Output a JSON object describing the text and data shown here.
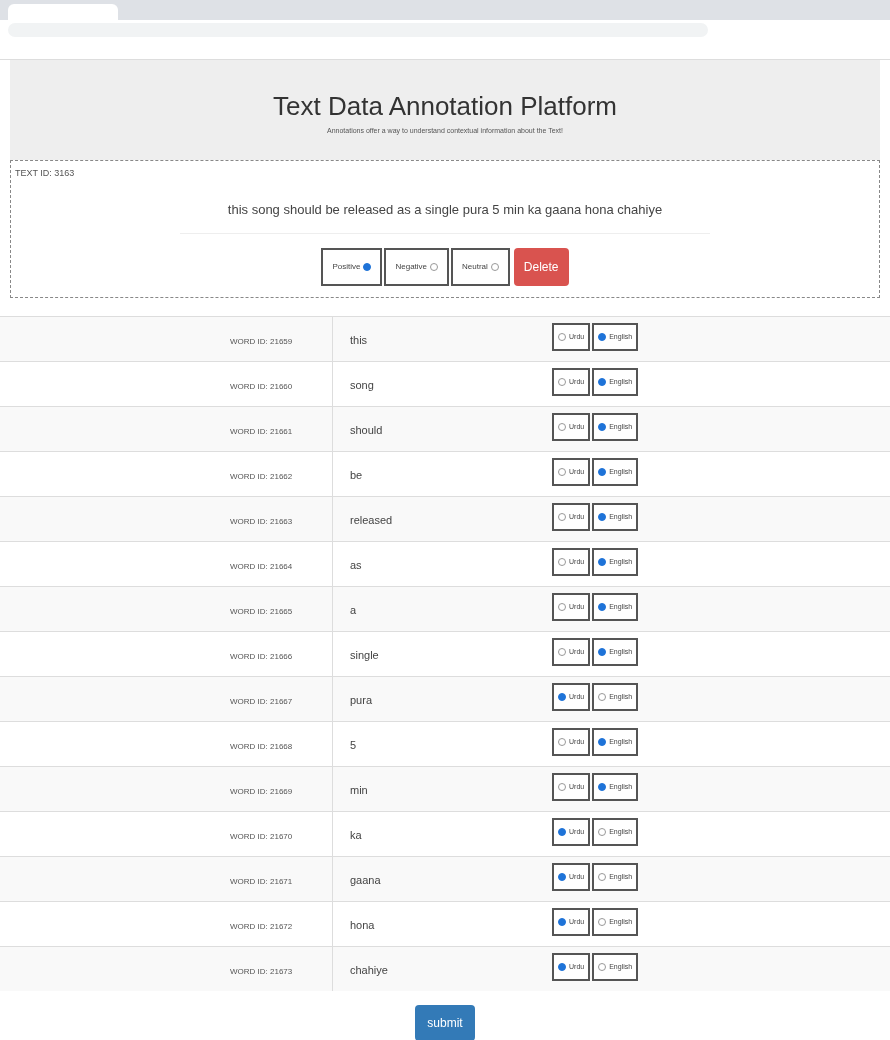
{
  "header": {
    "title": "Text Data Annotation Platform",
    "subtitle": "Annotations offer a way to understand contextual information about the Text!"
  },
  "text": {
    "id_label": "TEXT ID: 3163",
    "content": "this song should be released as a single pura 5 min ka gaana hona chahiye",
    "sentiments": [
      {
        "label": "Positive",
        "selected": true
      },
      {
        "label": "Negative",
        "selected": false
      },
      {
        "label": "Neutral",
        "selected": false
      }
    ],
    "delete_button": "Delete"
  },
  "words": [
    {
      "id_label": "WORD ID: 21659",
      "word": "this",
      "options": [
        {
          "label": "Urdu",
          "selected": false
        },
        {
          "label": "English",
          "selected": true
        }
      ]
    },
    {
      "id_label": "WORD ID: 21660",
      "word": "song",
      "options": [
        {
          "label": "Urdu",
          "selected": false
        },
        {
          "label": "English",
          "selected": true
        }
      ]
    },
    {
      "id_label": "WORD ID: 21661",
      "word": "should",
      "options": [
        {
          "label": "Urdu",
          "selected": false
        },
        {
          "label": "English",
          "selected": true
        }
      ]
    },
    {
      "id_label": "WORD ID: 21662",
      "word": "be",
      "options": [
        {
          "label": "Urdu",
          "selected": false
        },
        {
          "label": "English",
          "selected": true
        }
      ]
    },
    {
      "id_label": "WORD ID: 21663",
      "word": "released",
      "options": [
        {
          "label": "Urdu",
          "selected": false
        },
        {
          "label": "English",
          "selected": true
        }
      ]
    },
    {
      "id_label": "WORD ID: 21664",
      "word": "as",
      "options": [
        {
          "label": "Urdu",
          "selected": false
        },
        {
          "label": "English",
          "selected": true
        }
      ]
    },
    {
      "id_label": "WORD ID: 21665",
      "word": "a",
      "options": [
        {
          "label": "Urdu",
          "selected": false
        },
        {
          "label": "English",
          "selected": true
        }
      ]
    },
    {
      "id_label": "WORD ID: 21666",
      "word": "single",
      "options": [
        {
          "label": "Urdu",
          "selected": false
        },
        {
          "label": "English",
          "selected": true
        }
      ]
    },
    {
      "id_label": "WORD ID: 21667",
      "word": "pura",
      "options": [
        {
          "label": "Urdu",
          "selected": true
        },
        {
          "label": "English",
          "selected": false
        }
      ]
    },
    {
      "id_label": "WORD ID: 21668",
      "word": "5",
      "options": [
        {
          "label": "Urdu",
          "selected": false
        },
        {
          "label": "English",
          "selected": true
        }
      ]
    },
    {
      "id_label": "WORD ID: 21669",
      "word": "min",
      "options": [
        {
          "label": "Urdu",
          "selected": false
        },
        {
          "label": "English",
          "selected": true
        }
      ]
    },
    {
      "id_label": "WORD ID: 21670",
      "word": "ka",
      "options": [
        {
          "label": "Urdu",
          "selected": true
        },
        {
          "label": "English",
          "selected": false
        }
      ]
    },
    {
      "id_label": "WORD ID: 21671",
      "word": "gaana",
      "options": [
        {
          "label": "Urdu",
          "selected": true
        },
        {
          "label": "English",
          "selected": false
        }
      ]
    },
    {
      "id_label": "WORD ID: 21672",
      "word": "hona",
      "options": [
        {
          "label": "Urdu",
          "selected": true
        },
        {
          "label": "English",
          "selected": false
        }
      ]
    },
    {
      "id_label": "WORD ID: 21673",
      "word": "chahiye",
      "options": [
        {
          "label": "Urdu",
          "selected": true
        },
        {
          "label": "English",
          "selected": false
        }
      ]
    }
  ],
  "submit_button": "submit"
}
